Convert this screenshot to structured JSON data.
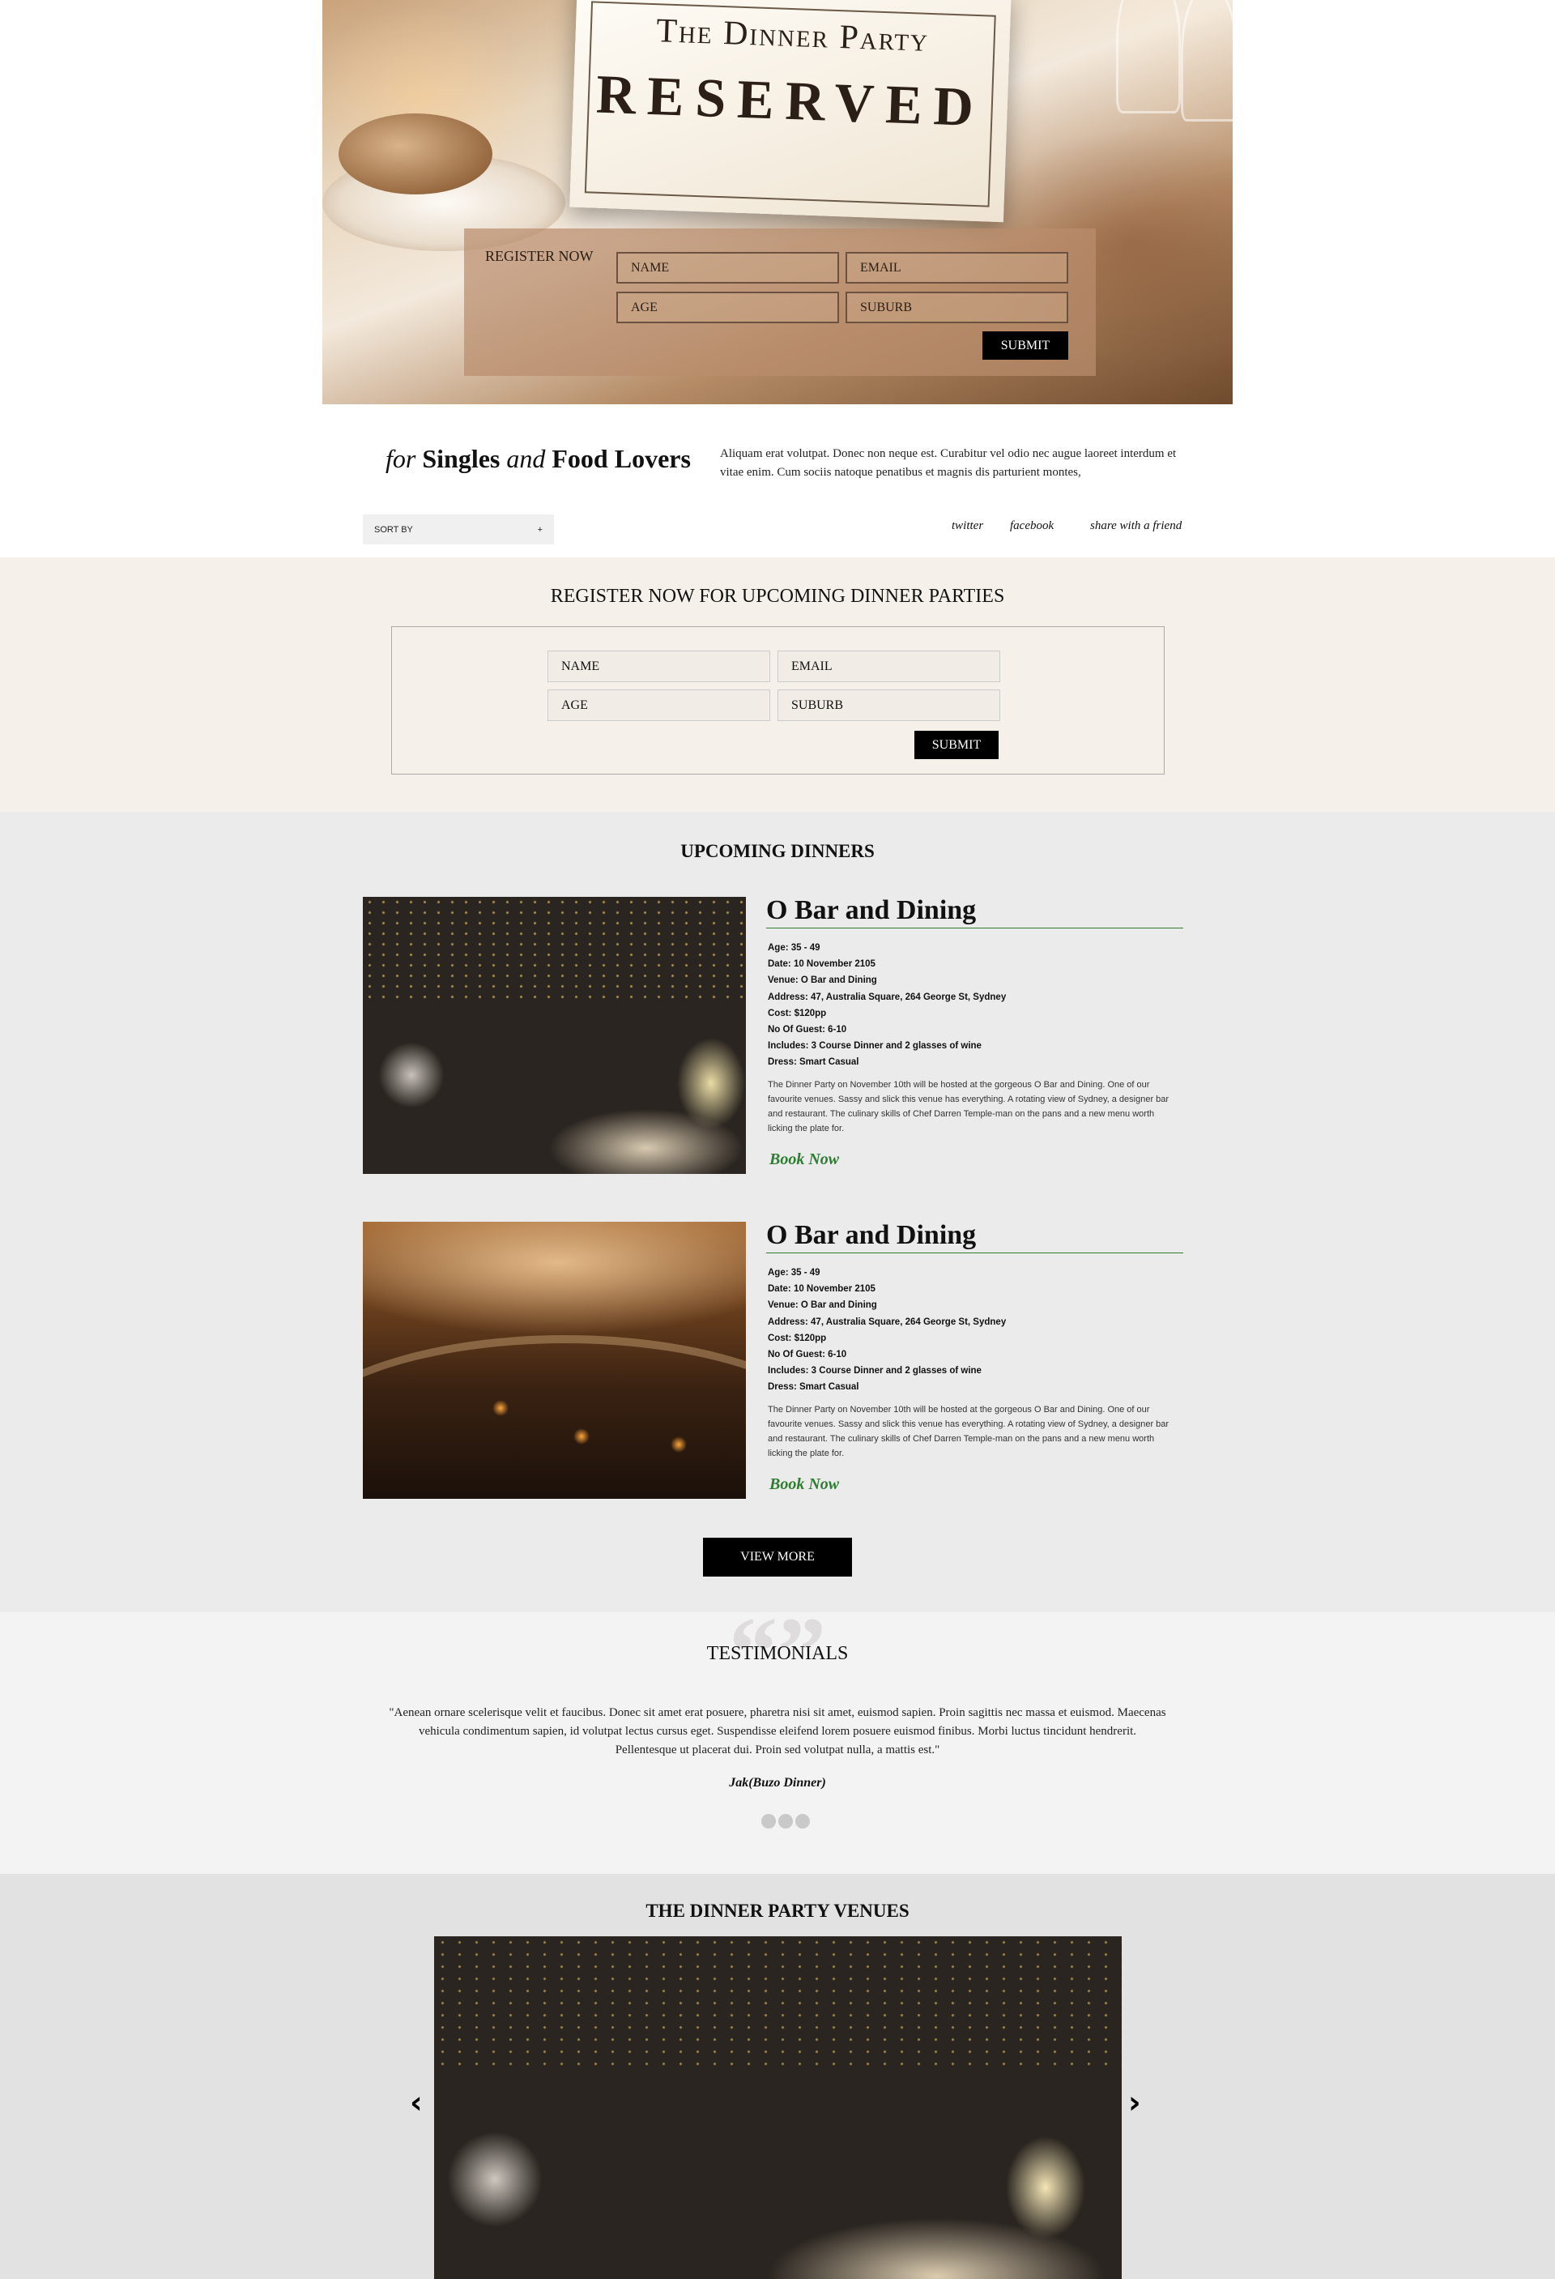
{
  "hero": {
    "card_subtitle": "The Dinner Party",
    "card_title": "RESERVED",
    "form_label": "REGISTER NOW",
    "name_placeholder": "NAME",
    "email_placeholder": "EMAIL",
    "age_placeholder": "AGE",
    "suburb_placeholder": "SUBURB",
    "submit_label": "SUBMIT"
  },
  "tagline": {
    "for": "for",
    "singles": "Singles",
    "and": "and",
    "food_lovers": "Food Lovers",
    "description": "Aliquam erat volutpat. Donec non neque est. Curabitur vel odio nec augue laoreet interdum et vitae enim. Cum sociis natoque penatibus et magnis dis parturient montes,"
  },
  "toolbar": {
    "sort_label": "SORT BY",
    "sort_icon": "+",
    "twitter": "twitter",
    "facebook": "facebook",
    "share": "share with a friend"
  },
  "register": {
    "title": "REGISTER NOW FOR UPCOMING DINNER PARTIES",
    "name_placeholder": "NAME",
    "email_placeholder": "EMAIL",
    "age_placeholder": "AGE",
    "suburb_placeholder": "SUBURB",
    "submit_label": "SUBMIT"
  },
  "upcoming": {
    "title": "UPCOMING DINNERS",
    "view_more": "VIEW MORE",
    "dinners": [
      {
        "name": "O Bar and Dining",
        "age": "Age: 35 - 49",
        "date": "Date: 10 November 2105",
        "venue": "Venue: O Bar and Dining",
        "address": "Address: 47, Australia Square, 264 George St, Sydney",
        "cost": "Cost: $120pp",
        "guests": "No Of Guest: 6-10",
        "includes": "Includes: 3 Course Dinner and 2 glasses of wine",
        "dress": "Dress: Smart Casual",
        "description": "The Dinner Party on November 10th will be hosted at the gorgeous O Bar and Dining. One of our favourite venues. Sassy and slick this venue has everything. A rotating view of Sydney, a designer bar and restaurant. The culinary skills of Chef Darren Temple-man on the pans and a new menu worth licking the plate for.",
        "book": "Book Now"
      },
      {
        "name": "O Bar and Dining",
        "age": "Age: 35 - 49",
        "date": "Date: 10 November 2105",
        "venue": "Venue: O Bar and Dining",
        "address": "Address: 47, Australia Square, 264 George St, Sydney",
        "cost": "Cost: $120pp",
        "guests": "No Of Guest: 6-10",
        "includes": "Includes: 3 Course Dinner and 2 glasses of wine",
        "dress": "Dress: Smart Casual",
        "description": "The Dinner Party on November 10th will be hosted at the gorgeous O Bar and Dining. One of our favourite venues. Sassy and slick this venue has everything. A rotating view of Sydney, a designer bar and restaurant. The culinary skills of Chef Darren Temple-man on the pans and a new menu worth licking the plate for.",
        "book": "Book Now"
      }
    ]
  },
  "testimonials": {
    "quote_mark": "“”",
    "title": "TESTIMONIALS",
    "text": "\"Aenean ornare scelerisque velit et faucibus. Donec sit amet erat posuere, pharetra nisi sit amet, euismod sapien. Proin sagittis nec massa et euismod. Maecenas vehicula condimentum sapien, id volutpat lectus cursus eget. Suspendisse eleifend lorem posuere euismod finibus. Morbi luctus tincidunt hendrerit. Pellentesque ut placerat dui. Proin sed volutpat nulla, a mattis est.\"",
    "author": "Jak(Buzo Dinner)"
  },
  "venues": {
    "title": "THE DINNER PARTY VENUES",
    "prev_icon": "‹",
    "next_icon": "›"
  },
  "colors": {
    "accent_green": "#2e7d32",
    "register_bg": "#f5f0ea",
    "upcoming_bg": "#ebebeb",
    "testimonials_bg": "#f4f3f4",
    "venues_bg": "#e2e2e2"
  }
}
